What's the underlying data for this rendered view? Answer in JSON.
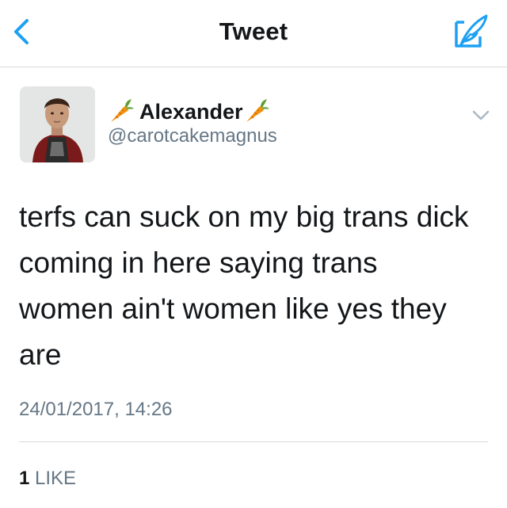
{
  "navbar": {
    "title": "Tweet",
    "back_icon": "chevron-left-icon",
    "compose_icon": "compose-feather-icon",
    "accent_color": "#1da1f2"
  },
  "tweet": {
    "display_name": "Alexander",
    "name_emoji": "carrot-icon",
    "handle": "@carotcakemagnus",
    "text": "terfs can suck on my big trans dick\ncoming in here saying trans\nwomen ain't women like yes they\nare",
    "timestamp": "24/01/2017, 14:26",
    "likes_count": "1",
    "likes_label": "LIKE",
    "menu_icon": "chevron-down-icon"
  }
}
